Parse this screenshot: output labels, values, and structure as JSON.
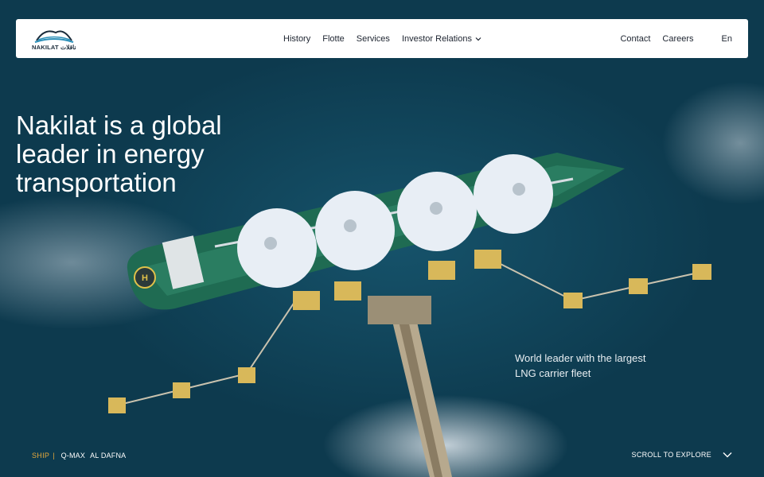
{
  "brand": {
    "logo_text": "NAKILAT ناقلات"
  },
  "nav": {
    "history": "History",
    "fleet": "Flotte",
    "services": "Services",
    "investor_relations": "Investor Relations",
    "contact": "Contact",
    "careers": "Careers",
    "language": "En"
  },
  "hero": {
    "headline": "Nakilat is a global leader in energy transportation",
    "tagline": "World leader with the largest LNG carrier fleet"
  },
  "ship_bar": {
    "label": "SHIP",
    "separator": "|",
    "ships": [
      "Q-MAX",
      "AL DAFNA"
    ]
  },
  "scroll": {
    "label": "SCROLL TO EXPLORE"
  },
  "colors": {
    "sea": "#0f4258",
    "accent": "#e6a93b",
    "hull": "#1f6b52",
    "tank": "#e8eef5"
  },
  "icons": {
    "dropdown": "chevron-down-icon",
    "scroll": "chevron-down-icon",
    "helipad": "helipad-icon"
  }
}
